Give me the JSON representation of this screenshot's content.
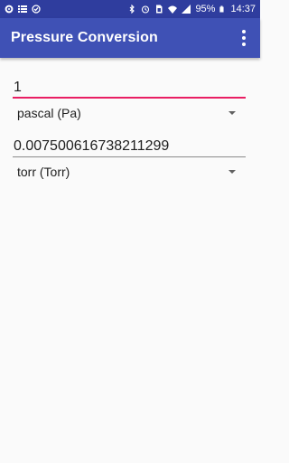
{
  "status_bar": {
    "battery": "95%",
    "time": "14:37",
    "left_icons": [
      "settings-icon",
      "list-icon",
      "sync-icon"
    ],
    "right_icons": [
      "bluetooth-mute-icon",
      "alarm-icon",
      "sim-icon",
      "wifi-icon",
      "signal-icon",
      "battery-icon"
    ]
  },
  "app_bar": {
    "title": "Pressure Conversion",
    "overflow_icon": "more-vert-icon"
  },
  "colors": {
    "status_bar": "#2f3d9e",
    "app_bar": "#3f51b5",
    "accent": "#e91e63"
  },
  "converter": {
    "input_value": "1",
    "from_unit": "pascal (Pa)",
    "output_value": "0.007500616738211299",
    "to_unit": "torr (Torr)"
  }
}
